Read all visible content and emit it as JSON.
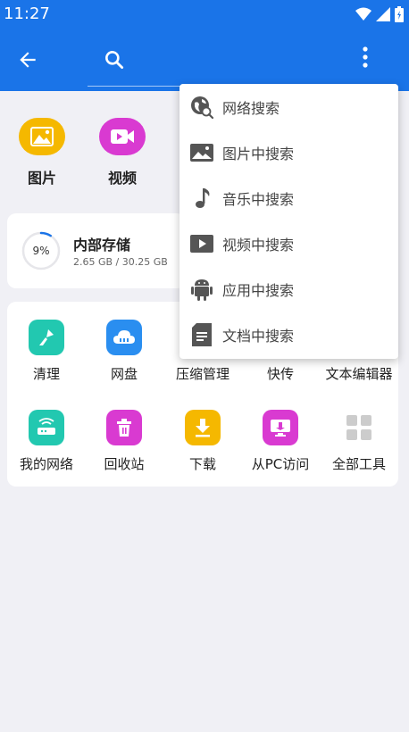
{
  "status_bar": {
    "time": "11:27",
    "icons": [
      "wifi-icon",
      "signal-icon",
      "battery-icon"
    ]
  },
  "app_bar": {
    "back_icon": "arrow-left-icon",
    "search_icon": "search-icon",
    "more_icon": "more-vert-icon",
    "color": "#1a74e8"
  },
  "quick_access": [
    {
      "label": "图片",
      "icon": "image-icon",
      "color": "#f5b800"
    },
    {
      "label": "视频",
      "icon": "video-icon",
      "color": "#d93ad1"
    }
  ],
  "storage": {
    "title": "内部存储",
    "percent": "9%",
    "used_fraction": 0.09,
    "size": "2.65 GB / 30.25 GB",
    "accent": "#1a74e8"
  },
  "tools": [
    {
      "label": "清理",
      "icon": "broom-icon",
      "color": "#22c8b0"
    },
    {
      "label": "网盘",
      "icon": "cloud-icon",
      "color": "#2a8ef0"
    },
    {
      "label": "压缩管理",
      "icon": "archive-icon",
      "color": "#f29a1a"
    },
    {
      "label": "快传",
      "icon": "transfer-icon",
      "color": "#7a5af0"
    },
    {
      "label": "文本编辑器",
      "icon": "text-edit-icon",
      "color": "#3aa0f0"
    },
    {
      "label": "我的网络",
      "icon": "router-icon",
      "color": "#22c8b0"
    },
    {
      "label": "回收站",
      "icon": "trash-icon",
      "color": "#d93ad1"
    },
    {
      "label": "下载",
      "icon": "download-icon",
      "color": "#f5b800"
    },
    {
      "label": "从PC访问",
      "icon": "pc-access-icon",
      "color": "#d93ad1"
    },
    {
      "label": "全部工具",
      "icon": "grid-icon",
      "color": "#cccccc"
    }
  ],
  "search_menu": [
    {
      "label": "网络搜索",
      "icon": "web-search-icon"
    },
    {
      "label": "图片中搜索",
      "icon": "image-icon"
    },
    {
      "label": "音乐中搜索",
      "icon": "music-icon"
    },
    {
      "label": "视频中搜索",
      "icon": "video-icon"
    },
    {
      "label": "应用中搜索",
      "icon": "android-icon"
    },
    {
      "label": "文档中搜索",
      "icon": "document-icon"
    }
  ]
}
